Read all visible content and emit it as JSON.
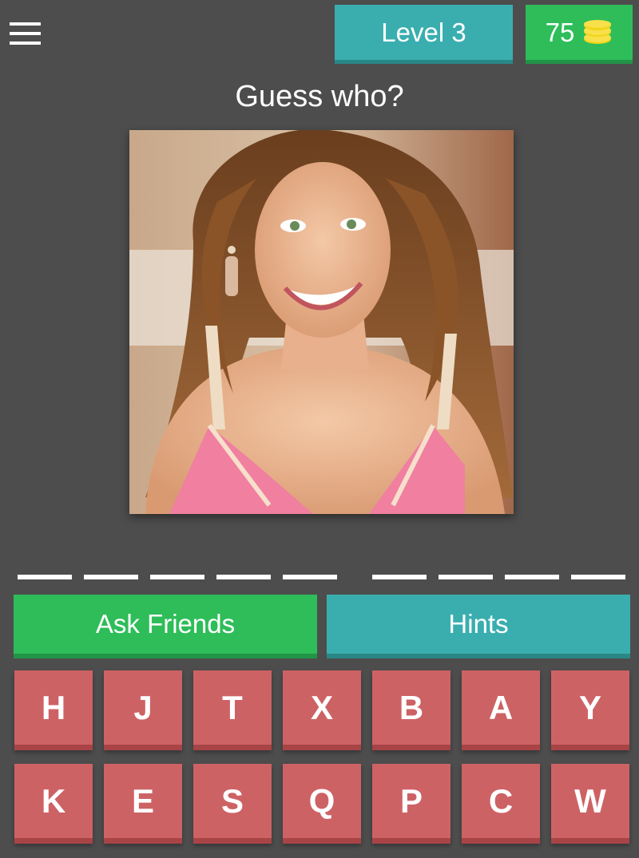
{
  "header": {
    "level_label": "Level 3",
    "coins": "75",
    "coin_icon": "coins-stack-icon",
    "menu_icon": "hamburger-menu-icon"
  },
  "prompt": "Guess who?",
  "photo": {
    "subject": "portrait-photo"
  },
  "answer_slots": {
    "word_lengths": [
      5,
      4
    ]
  },
  "actions": {
    "ask_friends_label": "Ask Friends",
    "hints_label": "Hints"
  },
  "keyboard": {
    "row1": [
      "H",
      "J",
      "T",
      "X",
      "B",
      "A",
      "Y"
    ],
    "row2": [
      "K",
      "E",
      "S",
      "Q",
      "P",
      "C",
      "W"
    ]
  },
  "colors": {
    "background": "#4d4d4d",
    "teal": "#3aaeaf",
    "green": "#2ebd59",
    "key_red": "#cd6265",
    "coin_yellow": "#f2d516"
  }
}
